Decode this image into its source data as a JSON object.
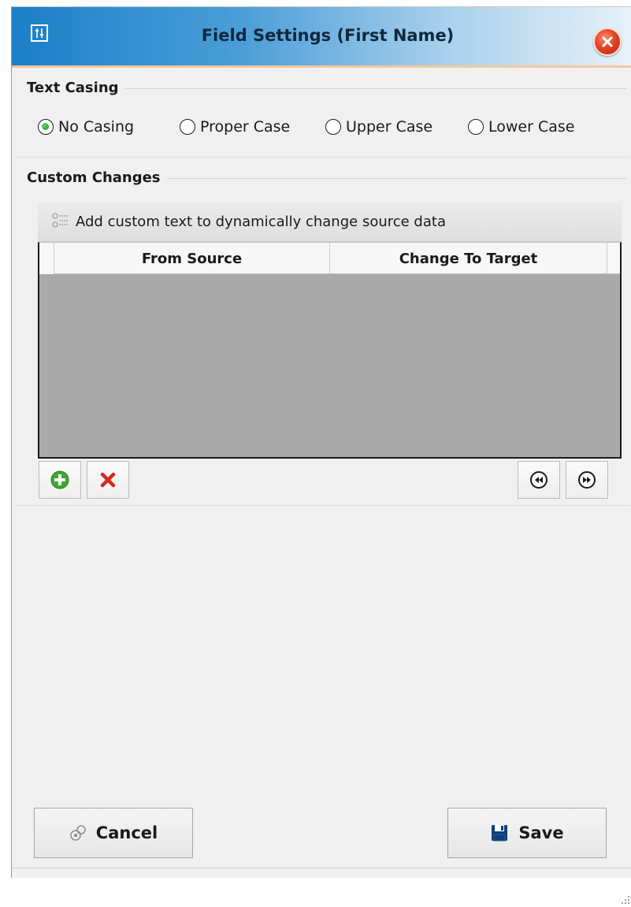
{
  "window": {
    "title": "Field Settings (First Name)",
    "app_icon": "settings-sliders-icon",
    "close_icon": "close-icon"
  },
  "text_casing": {
    "title": "Text Casing",
    "options": [
      {
        "label": "No Casing",
        "checked": true
      },
      {
        "label": "Proper Case",
        "checked": false
      },
      {
        "label": "Upper Case",
        "checked": false
      },
      {
        "label": "Lower Case",
        "checked": false
      }
    ]
  },
  "custom_changes": {
    "title": "Custom Changes",
    "header_text": "Add custom text to dynamically change source data",
    "header_icon": "list-options-icon",
    "columns": [
      "From Source",
      "Change To Target"
    ],
    "rows": [],
    "toolbar": {
      "add_icon": "add-icon",
      "delete_icon": "delete-icon",
      "move_back_icon": "rewind-icon",
      "move_forward_icon": "fast-forward-icon"
    }
  },
  "actions": {
    "cancel_label": "Cancel",
    "cancel_icon": "cancel-icon",
    "save_label": "Save",
    "save_icon": "save-icon"
  },
  "colors": {
    "title_gradient_start": "#1b7fc8",
    "title_gradient_end": "#e6f1fa",
    "grid_body": "#aaaaaa",
    "radio_checked": "#178d2a",
    "close_button": "#e2452a"
  }
}
